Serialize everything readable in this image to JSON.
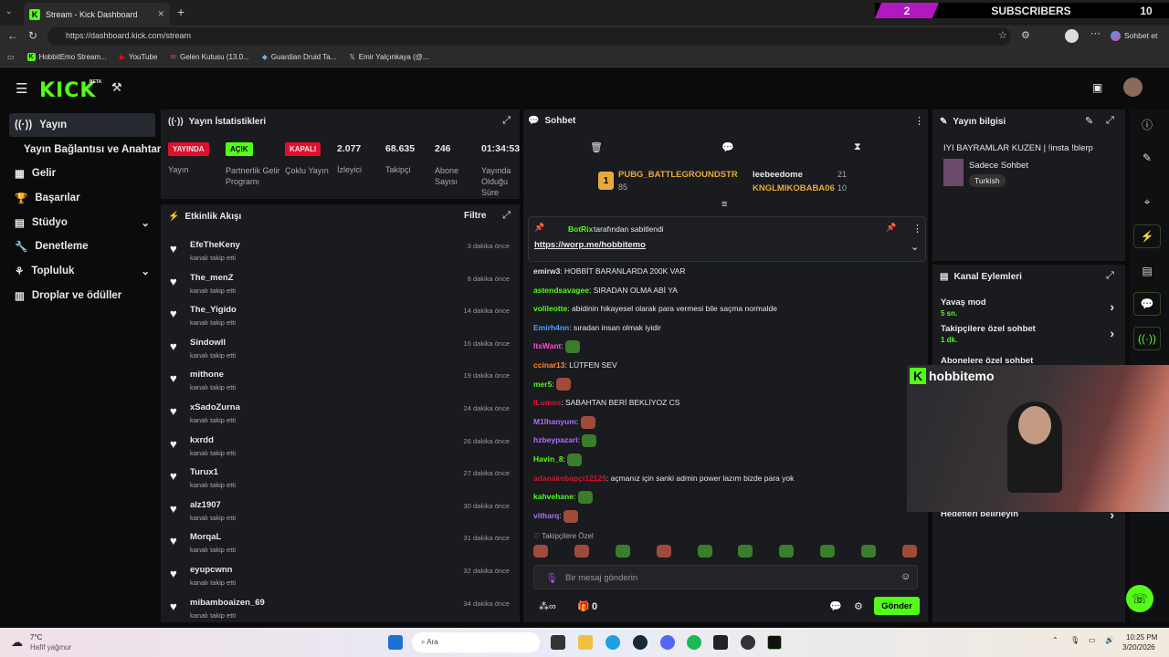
{
  "browser": {
    "tab_title": "Stream - Kick Dashboard",
    "url": "https://dashboard.kick.com/stream",
    "copilot_label": "Sohbet et",
    "bookmarks": [
      "HobbitEmo Stream...",
      "YouTube",
      "Gelen Kutusu (13.0...",
      "Guardian Druid Ta...",
      "Emir Yalçınkaya (@..."
    ]
  },
  "overlay": {
    "sub_count": "2",
    "label": "SUBSCRIBERS",
    "goal": "10"
  },
  "header": {
    "logo": "KICK",
    "logo_badge": "BETA"
  },
  "sidebar": {
    "items": [
      {
        "label": "Yayın"
      },
      {
        "label": "Yayın Bağlantısı ve Anahtarı"
      },
      {
        "label": "Gelir"
      },
      {
        "label": "Başarılar"
      },
      {
        "label": "Stüdyo"
      },
      {
        "label": "Denetleme"
      },
      {
        "label": "Topluluk"
      },
      {
        "label": "Droplar ve ödüller"
      }
    ]
  },
  "stats": {
    "title": "Yayın İstatistikleri",
    "status": [
      {
        "badge": "YAYINDA",
        "label": "Yayın",
        "color": "#e0102c"
      },
      {
        "badge": "AÇIK",
        "label": "Partnerlik Gelir Programı",
        "color": "#53fc18"
      },
      {
        "badge": "KAPALI",
        "label": "Çoklu Yayın",
        "color": "#e0102c"
      }
    ],
    "numbers": [
      {
        "value": "2.077",
        "label": "İzleyici"
      },
      {
        "value": "68.635",
        "label": "Takipçi"
      },
      {
        "value": "246",
        "label": "Abone Sayısı"
      },
      {
        "value": "01:34:53",
        "label": "Yayında Olduğu Süre"
      }
    ]
  },
  "activity": {
    "title": "Etkinlik Akışı",
    "filter": "Filtre",
    "action": "kanalı takip etti",
    "events": [
      {
        "name": "EfeTheKeny",
        "time": "3 dakika önce"
      },
      {
        "name": "The_menZ",
        "time": "8 dakika önce"
      },
      {
        "name": "The_Yigido",
        "time": "14 dakika önce"
      },
      {
        "name": "Sindowll",
        "time": "16 dakika önce"
      },
      {
        "name": "mithone",
        "time": "19 dakika önce"
      },
      {
        "name": "xSadoZurna",
        "time": "24 dakika önce"
      },
      {
        "name": "kxrdd",
        "time": "26 dakika önce"
      },
      {
        "name": "Turux1",
        "time": "27 dakika önce"
      },
      {
        "name": "alz1907",
        "time": "30 dakika önce"
      },
      {
        "name": "MorqaL",
        "time": "31 dakika önce"
      },
      {
        "name": "eyupcwnn",
        "time": "32 dakika önce"
      },
      {
        "name": "mibamboaizen_69",
        "time": "34 dakika önce"
      }
    ]
  },
  "chat": {
    "title": "Sohbet",
    "leaders": [
      {
        "name": "PUBG_BATTLEGROUNDSTR",
        "count": "85"
      },
      {
        "name": "leebeedome",
        "count": "21"
      },
      {
        "name": "KNGLMIKOBABA06",
        "count": "10"
      }
    ],
    "pinned": {
      "by": "BotRix",
      "by_suffix": "tarafından sabitlendi",
      "link": "https://worp.me/hobbitemo"
    },
    "messages": [
      {
        "user": "emirw3",
        "text": "HOBBİT BARANLARDA 200K VAR",
        "color": "#e0e0e0"
      },
      {
        "user": "astendsavagee",
        "text": "SIRADAN OLMA ABİ YA",
        "color": "#53fc18"
      },
      {
        "user": "volileotte",
        "text": "abidinin hikayesel olarak para vermesi bile saçma normalde",
        "color": "#53fc18"
      },
      {
        "user": "Emirh4nn",
        "text": "sıradan insan olmak iyidir",
        "color": "#4aa3ff"
      },
      {
        "user": "ItsWant",
        "text": "",
        "color": "#ff4ad0"
      },
      {
        "user": "ccinar13",
        "text": "LÜTFEN SEV",
        "color": "#ff8a2a"
      },
      {
        "user": "mer5",
        "text": "",
        "color": "#53fc18"
      },
      {
        "user": "ILumos",
        "text": "SABAHTAN BERİ BEKLİYOZ CS",
        "color": "#e0102c"
      },
      {
        "user": "M1lhanyum",
        "text": "",
        "color": "#b06cff"
      },
      {
        "user": "hzbeypazari",
        "text": "",
        "color": "#b06cff"
      },
      {
        "user": "Havin_8",
        "text": "",
        "color": "#53fc18"
      },
      {
        "user": "adanakebapçi12125",
        "text": "açmanız için sanki admin power lazım bizde para yok",
        "color": "#e0102c"
      },
      {
        "user": "kahvehane",
        "text": "",
        "color": "#53fc18"
      },
      {
        "user": "vitharq",
        "text": "",
        "color": "#b06cff"
      }
    ],
    "followers_only": "Takipçilere Özel",
    "input_placeholder": "Bir mesaj gönderin",
    "points": "0",
    "send": "Gönder"
  },
  "info": {
    "title": "Yayın bilgisi",
    "stream_title": "IYI BAYRAMLAR KUZEN | !insta !blerp",
    "category": "Sadece Sohbet",
    "language": "Turkish"
  },
  "actions": {
    "title": "Kanal Eylemleri",
    "rows": [
      {
        "label": "Yavaş mod",
        "value": "5 sn."
      },
      {
        "label": "Takipçilere özel sohbet",
        "value": "1 dk."
      },
      {
        "label": "Abonelere özel sohbet",
        "value": ""
      },
      {
        "label": "Hedefleri belirleyin",
        "value": ""
      }
    ]
  },
  "cam": {
    "name": "hobbitemo"
  },
  "taskbar": {
    "temp": "7°C",
    "weather": "Hafif yağmur",
    "search": "Ara",
    "time": "10:25 PM",
    "date": "3/20/2026"
  }
}
